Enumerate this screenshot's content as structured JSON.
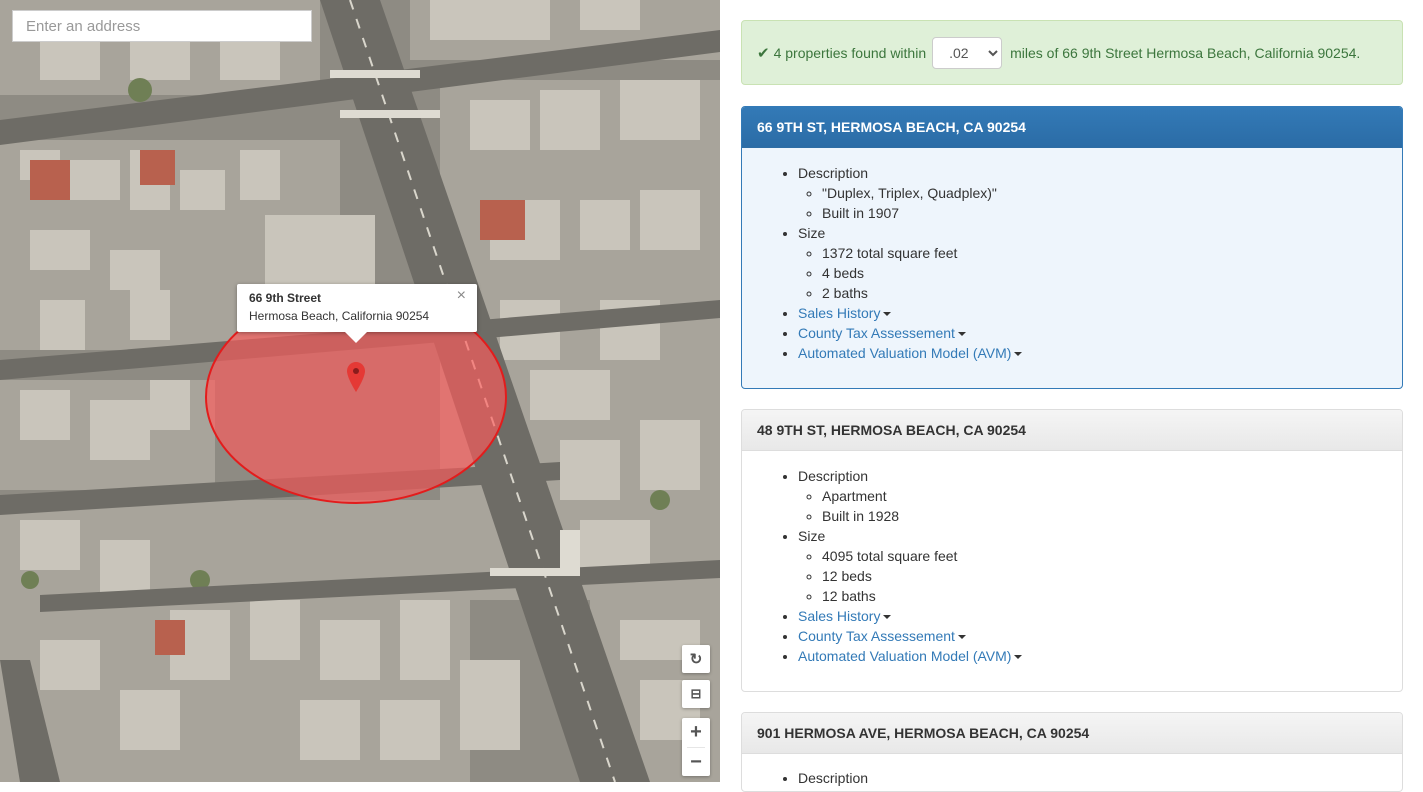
{
  "map": {
    "search_placeholder": "Enter an address",
    "infowindow": {
      "line1": "66 9th Street",
      "line2": "Hermosa Beach, California 90254",
      "close": "×"
    },
    "controls": {
      "rotate": "↻",
      "tilt": "⊟",
      "zoom_in": "+",
      "zoom_out": "−"
    },
    "icons": [
      "map-marker-icon",
      "rotate-icon",
      "tilt-icon",
      "zoom-in-icon",
      "zoom-out-icon"
    ],
    "colors": {
      "radius_fill": "#ff5a5a",
      "radius_stroke": "#e31c1c",
      "marker": "#e53935"
    }
  },
  "alert": {
    "icon": "✔",
    "prefix": "4 properties found within",
    "radius_value": ".02",
    "suffix": "miles of 66 9th Street Hermosa Beach, California 90254."
  },
  "properties": [
    {
      "title": "66 9TH ST, HERMOSA BEACH, CA 90254",
      "description_label": "Description",
      "description": [
        "\"Duplex, Triplex, Quadplex)\"",
        "Built in 1907"
      ],
      "size_label": "Size",
      "size": [
        "1372 total square feet",
        "4 beds",
        "2 baths"
      ],
      "links": [
        "Sales History",
        "County Tax Assessement",
        "Automated Valuation Model (AVM)"
      ]
    },
    {
      "title": "48 9TH ST, HERMOSA BEACH, CA 90254",
      "description_label": "Description",
      "description": [
        "Apartment",
        "Built in 1928"
      ],
      "size_label": "Size",
      "size": [
        "4095 total square feet",
        "12 beds",
        "12 baths"
      ],
      "links": [
        "Sales History",
        "County Tax Assessement",
        "Automated Valuation Model (AVM)"
      ]
    },
    {
      "title": "901 HERMOSA AVE, HERMOSA BEACH, CA 90254",
      "description_label": "Description"
    }
  ],
  "colors": {
    "primary": "#337ab7",
    "success_bg": "#dff0d8",
    "success_text": "#3c763d"
  }
}
